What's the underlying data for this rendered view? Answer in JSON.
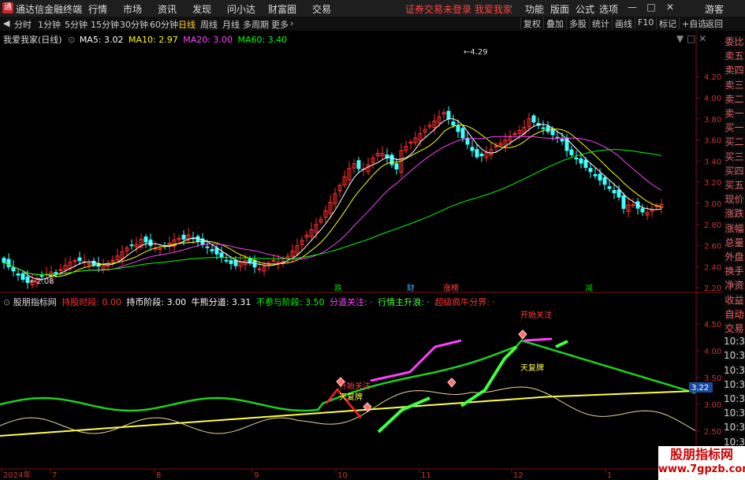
{
  "app": {
    "title": "通达信金融终端",
    "logo": "通"
  },
  "menu": {
    "items": [
      "行情",
      "市场",
      "资讯",
      "发现",
      "问小达",
      "财富圈",
      "交易"
    ],
    "warning": "证券交易未登录  我爱我家",
    "right": [
      "功能",
      "版面",
      "公式",
      "选项"
    ],
    "right2": "游客"
  },
  "toolbar": {
    "periods": [
      "分时",
      "1分钟",
      "5分钟",
      "15分钟",
      "30分钟",
      "60分钟",
      "日线",
      "周线",
      "月线",
      "多周期",
      "更多"
    ],
    "active": "日线",
    "right": [
      "复权",
      "叠加",
      "多股",
      "统计",
      "画线",
      "F10",
      "标记",
      "+自选",
      "返回"
    ]
  },
  "main_chart": {
    "legend_name": "我爱我家(日线)",
    "ma": [
      {
        "label": "MA5: 3.02",
        "color": "#ffffff"
      },
      {
        "label": "MA10: 2.97",
        "color": "#ffff00"
      },
      {
        "label": "MA20: 3.00",
        "color": "#ff40ff"
      },
      {
        "label": "MA60: 3.40",
        "color": "#00ff00"
      }
    ],
    "yticks": [
      "4.20",
      "4.00",
      "3.80",
      "3.60",
      "3.40",
      "3.20",
      "3.00",
      "2.80",
      "2.60",
      "2.40",
      "2.20"
    ],
    "high_label": "4.29",
    "low_label": "2.08",
    "markers": [
      "跌",
      "财",
      "涨榜",
      "减"
    ]
  },
  "indicator": {
    "name": "股朋指标网",
    "items": [
      {
        "label": "持股时段: 0.00",
        "color": "#ff3030"
      },
      {
        "label": "持币阶段: 3.00",
        "color": "#ffffff"
      },
      {
        "label": "牛熊分道: 3.31",
        "color": "#ffffff"
      },
      {
        "label": "不参与阶段: 3.50",
        "color": "#00ff00"
      },
      {
        "label": "分道关注: ·",
        "color": "#ff40ff"
      },
      {
        "label": "行情主升浪: ·",
        "color": "#40ff40"
      },
      {
        "label": "超级疯牛分界: ·",
        "color": "#ff3030"
      }
    ],
    "yticks": [
      "4.50",
      "4.00",
      "3.50",
      "3.00",
      "2.50"
    ],
    "current": "3.22",
    "annotations": [
      "开始关注",
      "天复牌",
      "开始关注",
      "天复牌"
    ]
  },
  "right_panel": [
    "委比",
    "卖五",
    "卖四",
    "卖三",
    "卖二",
    "卖一",
    "买一",
    "买二",
    "买三",
    "买四",
    "买五",
    "现价",
    "涨跌",
    "涨幅",
    "总量",
    "外盘",
    "换手",
    "净资",
    "收益",
    "自动",
    "交易",
    "10:3",
    "10:3",
    "10:3",
    "10:3",
    "10:3",
    "10:3",
    "10:3",
    "10:3"
  ],
  "xaxis": [
    "2024年",
    "7",
    "8",
    "9",
    "10",
    "11",
    "12",
    "1"
  ],
  "watermark": {
    "title": "股朋指标网",
    "url": "www.7gpzb.com"
  }
}
